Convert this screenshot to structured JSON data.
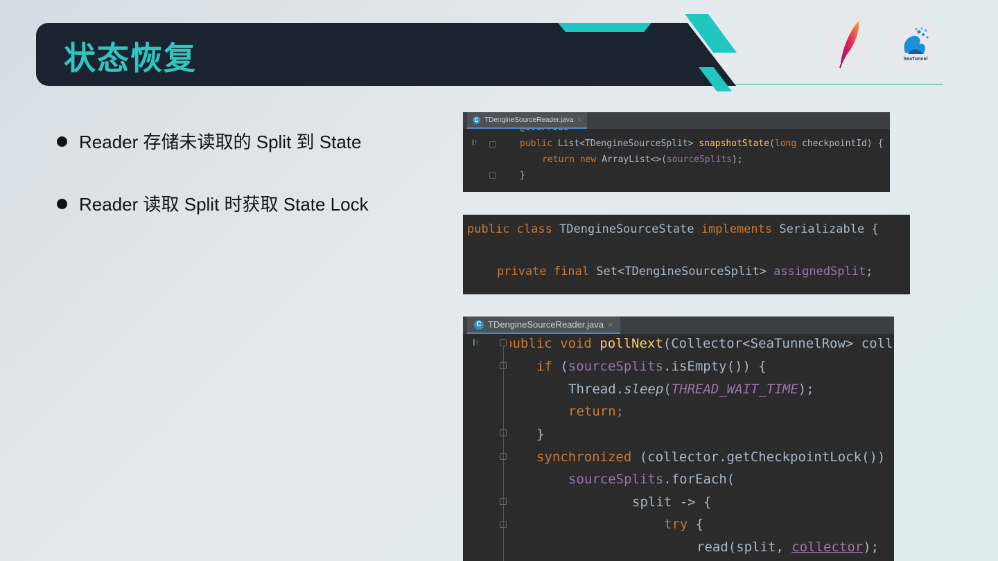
{
  "slide": {
    "title": "状态恢复",
    "bullets": [
      "Reader 存储未读取的 Split 到 State",
      "Reader 读取 Split 时获取  State Lock"
    ],
    "logos": {
      "apache_icon": "apache-feather-icon",
      "seatunnel_label": "SeaTunnel"
    }
  },
  "colors": {
    "title": "#2ec6bf",
    "accent": "#20c6c0",
    "title_bar": "#1b2230",
    "code_bg": "#2b2b2b"
  },
  "code1": {
    "tab_icon": "C",
    "tab": "TDengineSourceReader.java",
    "close": "×",
    "line0": "@Override",
    "l1": {
      "kw": "public ",
      "t1": "List<TDengineSourceSplit> ",
      "fn": "snapshotState",
      "t2": "(",
      "kw2": "long ",
      "t3": "checkpointId) {"
    },
    "l2": {
      "kw": "return new ",
      "t1": "ArrayList<>(",
      "field": "sourceSplits",
      "t2": ");"
    },
    "l3": "}"
  },
  "code2": {
    "l1": {
      "kw": "public class ",
      "t1": "TDengineSourceState ",
      "kw2": "implements ",
      "t2": "Serializable {"
    },
    "l2": {
      "kw": "private final ",
      "t1": "Set<TDengineSourceSplit> ",
      "field": "assignedSplit",
      "t2": ";"
    }
  },
  "code3": {
    "tab_icon": "C",
    "tab": "TDengineSourceReader.java",
    "close": "×",
    "l1": {
      "kw": "public void ",
      "fn": "pollNext",
      "t1": "(Collector<SeaTunnelRow> coll"
    },
    "l2": {
      "kw": "if ",
      "t1": "(",
      "field": "sourceSplits",
      "t2": ".isEmpty()) {"
    },
    "l3": {
      "t1": "Thread.",
      "ital": "sleep",
      "t2": "(",
      "field": "THREAD_WAIT_TIME",
      "t3": ");"
    },
    "l4": {
      "kw": "return;"
    },
    "l5": "}",
    "l6": {
      "kw": "synchronized ",
      "t1": "(collector.getCheckpointLock())"
    },
    "l7": {
      "field": "sourceSplits",
      "t1": ".forEach("
    },
    "l8": "split -> {",
    "l9": {
      "kw": "try ",
      "t1": "{"
    },
    "l10": {
      "t1": "read(split, ",
      "und": "collector",
      "t2": ");"
    }
  }
}
